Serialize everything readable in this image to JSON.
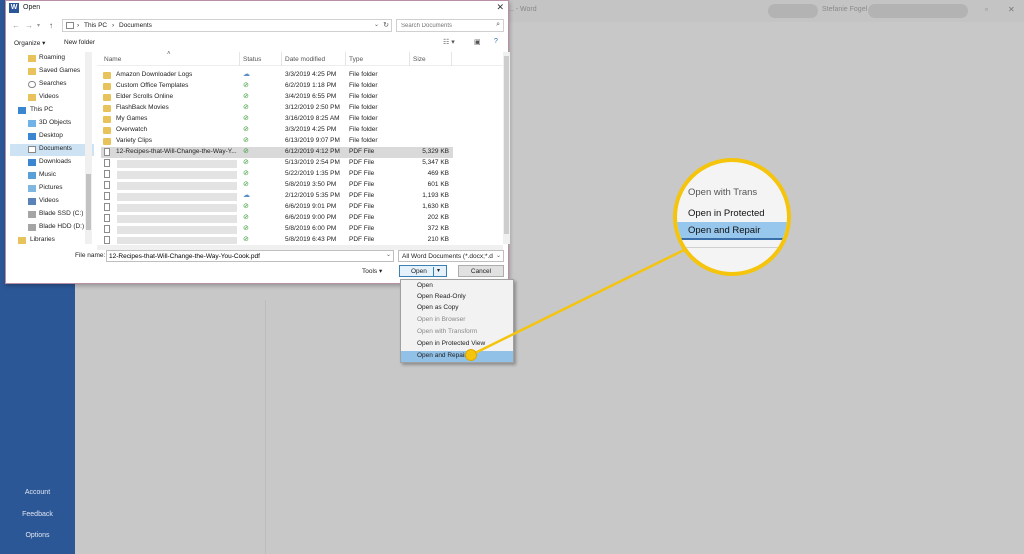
{
  "word": {
    "title": "... - Word",
    "user": "Stefanie Fogel",
    "sidebar_bottom": [
      "Account",
      "Feedback",
      "Options"
    ]
  },
  "dialog": {
    "title": "Open",
    "address": {
      "crumbs": [
        "This PC",
        "Documents"
      ]
    },
    "search_placeholder": "Search Documents",
    "toolbar": {
      "organize": "Organize ▾",
      "new_folder": "New folder"
    },
    "nav_items": [
      {
        "label": "Roaming",
        "icon": "folder-icon"
      },
      {
        "label": "Saved Games",
        "icon": "folder-icon"
      },
      {
        "label": "Searches",
        "icon": "search-icon"
      },
      {
        "label": "Videos",
        "icon": "folder-icon"
      },
      {
        "label": "This PC",
        "icon": "computer-icon"
      },
      {
        "label": "3D Objects",
        "icon": "cube-icon"
      },
      {
        "label": "Desktop",
        "icon": "desktop-icon"
      },
      {
        "label": "Documents",
        "icon": "documents-icon",
        "selected": true
      },
      {
        "label": "Downloads",
        "icon": "download-icon"
      },
      {
        "label": "Music",
        "icon": "music-icon"
      },
      {
        "label": "Pictures",
        "icon": "pictures-icon"
      },
      {
        "label": "Videos",
        "icon": "video-icon"
      },
      {
        "label": "Blade SSD (C:)",
        "icon": "drive-icon"
      },
      {
        "label": "Blade HDD (D:)",
        "icon": "drive-icon"
      },
      {
        "label": "Libraries",
        "icon": "library-icon"
      }
    ],
    "columns": [
      "Name",
      "Status",
      "Date modified",
      "Type",
      "Size"
    ],
    "files": [
      {
        "name": "Amazon Downloader Logs",
        "status": "cloud",
        "date": "3/3/2019 4:25 PM",
        "type": "File folder",
        "size": "",
        "kind": "folder"
      },
      {
        "name": "Custom Office Templates",
        "status": "ok",
        "date": "6/2/2019 1:18 PM",
        "type": "File folder",
        "size": "",
        "kind": "folder"
      },
      {
        "name": "Elder Scrolls Online",
        "status": "ok",
        "date": "3/4/2019 6:55 PM",
        "type": "File folder",
        "size": "",
        "kind": "folder"
      },
      {
        "name": "FlashBack Movies",
        "status": "ok",
        "date": "3/12/2019 2:50 PM",
        "type": "File folder",
        "size": "",
        "kind": "folder"
      },
      {
        "name": "My Games",
        "status": "ok",
        "date": "3/16/2019 8:25 AM",
        "type": "File folder",
        "size": "",
        "kind": "folder"
      },
      {
        "name": "Overwatch",
        "status": "ok",
        "date": "3/3/2019 4:25 PM",
        "type": "File folder",
        "size": "",
        "kind": "folder"
      },
      {
        "name": "Variety Clips",
        "status": "ok",
        "date": "6/13/2019 9:07 PM",
        "type": "File folder",
        "size": "",
        "kind": "folder"
      },
      {
        "name": "12-Recipes-that-Will-Change-the-Way-Y...",
        "status": "ok",
        "date": "6/12/2019 4:12 PM",
        "type": "PDF File",
        "size": "5,329 KB",
        "kind": "pdf",
        "selected": true
      },
      {
        "name": "",
        "status": "ok",
        "date": "5/13/2019 2:54 PM",
        "type": "PDF File",
        "size": "5,347 KB",
        "kind": "pdf"
      },
      {
        "name": "",
        "status": "ok",
        "date": "5/22/2019 1:35 PM",
        "type": "PDF File",
        "size": "469 KB",
        "kind": "pdf"
      },
      {
        "name": "",
        "status": "ok",
        "date": "5/8/2019 3:50 PM",
        "type": "PDF File",
        "size": "601 KB",
        "kind": "pdf"
      },
      {
        "name": "",
        "status": "cloud",
        "date": "2/12/2019 5:35 PM",
        "type": "PDF File",
        "size": "1,193 KB",
        "kind": "pdf"
      },
      {
        "name": "",
        "status": "ok",
        "date": "6/6/2019 9:01 PM",
        "type": "PDF File",
        "size": "1,630 KB",
        "kind": "pdf"
      },
      {
        "name": "",
        "status": "ok",
        "date": "6/6/2019 9:00 PM",
        "type": "PDF File",
        "size": "202 KB",
        "kind": "pdf"
      },
      {
        "name": "",
        "status": "ok",
        "date": "5/8/2019 6:00 PM",
        "type": "PDF File",
        "size": "372 KB",
        "kind": "pdf"
      },
      {
        "name": "",
        "status": "ok",
        "date": "5/8/2019 6:43 PM",
        "type": "PDF File",
        "size": "210 KB",
        "kind": "pdf"
      }
    ],
    "file_name_label": "File name:",
    "file_name_value": "12-Recipes-that-Will-Change-the-Way-You-Cook.pdf",
    "file_type": "All Word Documents (*.docx;*.d",
    "tools_label": "Tools",
    "open_label": "Open",
    "cancel_label": "Cancel"
  },
  "open_menu": [
    {
      "label": "Open",
      "disabled": false
    },
    {
      "label": "Open Read-Only",
      "disabled": false
    },
    {
      "label": "Open as Copy",
      "disabled": false
    },
    {
      "label": "Open in Browser",
      "disabled": true
    },
    {
      "label": "Open with Transform",
      "disabled": true
    },
    {
      "label": "Open in Protected View",
      "disabled": false
    },
    {
      "label": "Open and Repair",
      "disabled": false,
      "highlighted": true
    }
  ],
  "zoom": {
    "item_top": "Open with Trans",
    "item_protected": "Open in Protected",
    "item_repair": "Open and Repair"
  },
  "colors": {
    "callout": "#f5c40d",
    "highlight": "#91c1e7",
    "word_blue": "#2b5797"
  }
}
